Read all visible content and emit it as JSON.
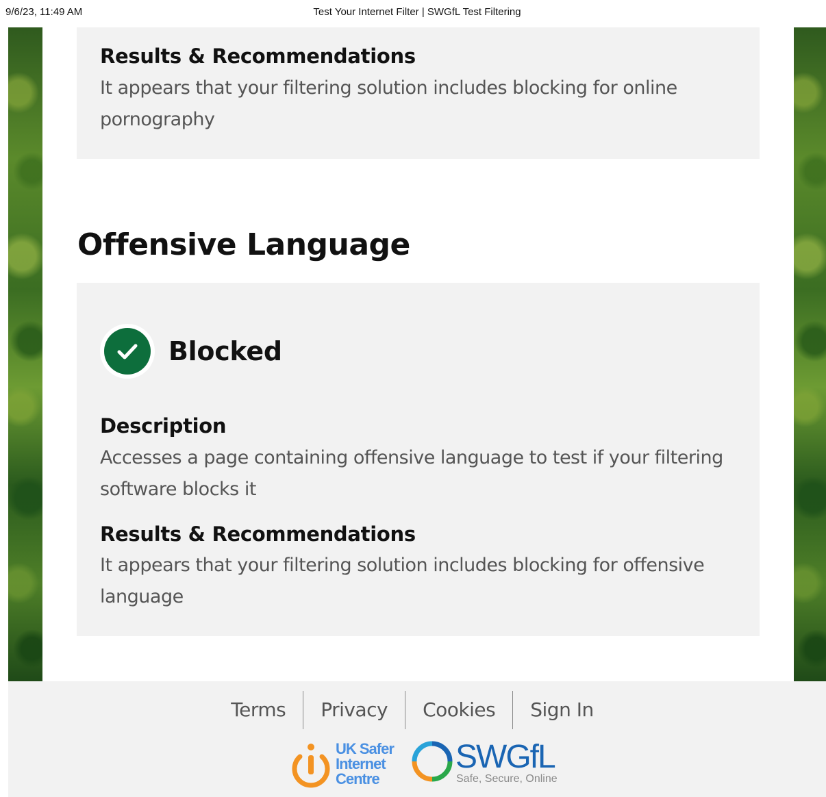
{
  "print_header": {
    "datetime": "9/6/23, 11:49 AM",
    "page_title": "Test Your Internet Filter | SWGfL Test Filtering"
  },
  "previous_result": {
    "heading": "Results & Recommendations",
    "text": "It appears that your filtering solution includes blocking for online pornography"
  },
  "section": {
    "title": "Offensive Language",
    "status": {
      "label": "Blocked",
      "icon": "check-circle-icon",
      "color": "#0d6e3c"
    },
    "description_heading": "Description",
    "description_text": "Accesses a page containing offensive language to test if your filtering software blocks it",
    "results_heading": "Results & Recommendations",
    "results_text": "It appears that your filtering solution includes blocking for offensive language"
  },
  "footer": {
    "links": [
      "Terms",
      "Privacy",
      "Cookies",
      "Sign In"
    ],
    "logos": {
      "uksic": [
        "UK Safer",
        "Internet",
        "Centre"
      ],
      "swgfl_name": "SWGfL",
      "swgfl_tagline": "Safe, Secure, Online"
    }
  }
}
